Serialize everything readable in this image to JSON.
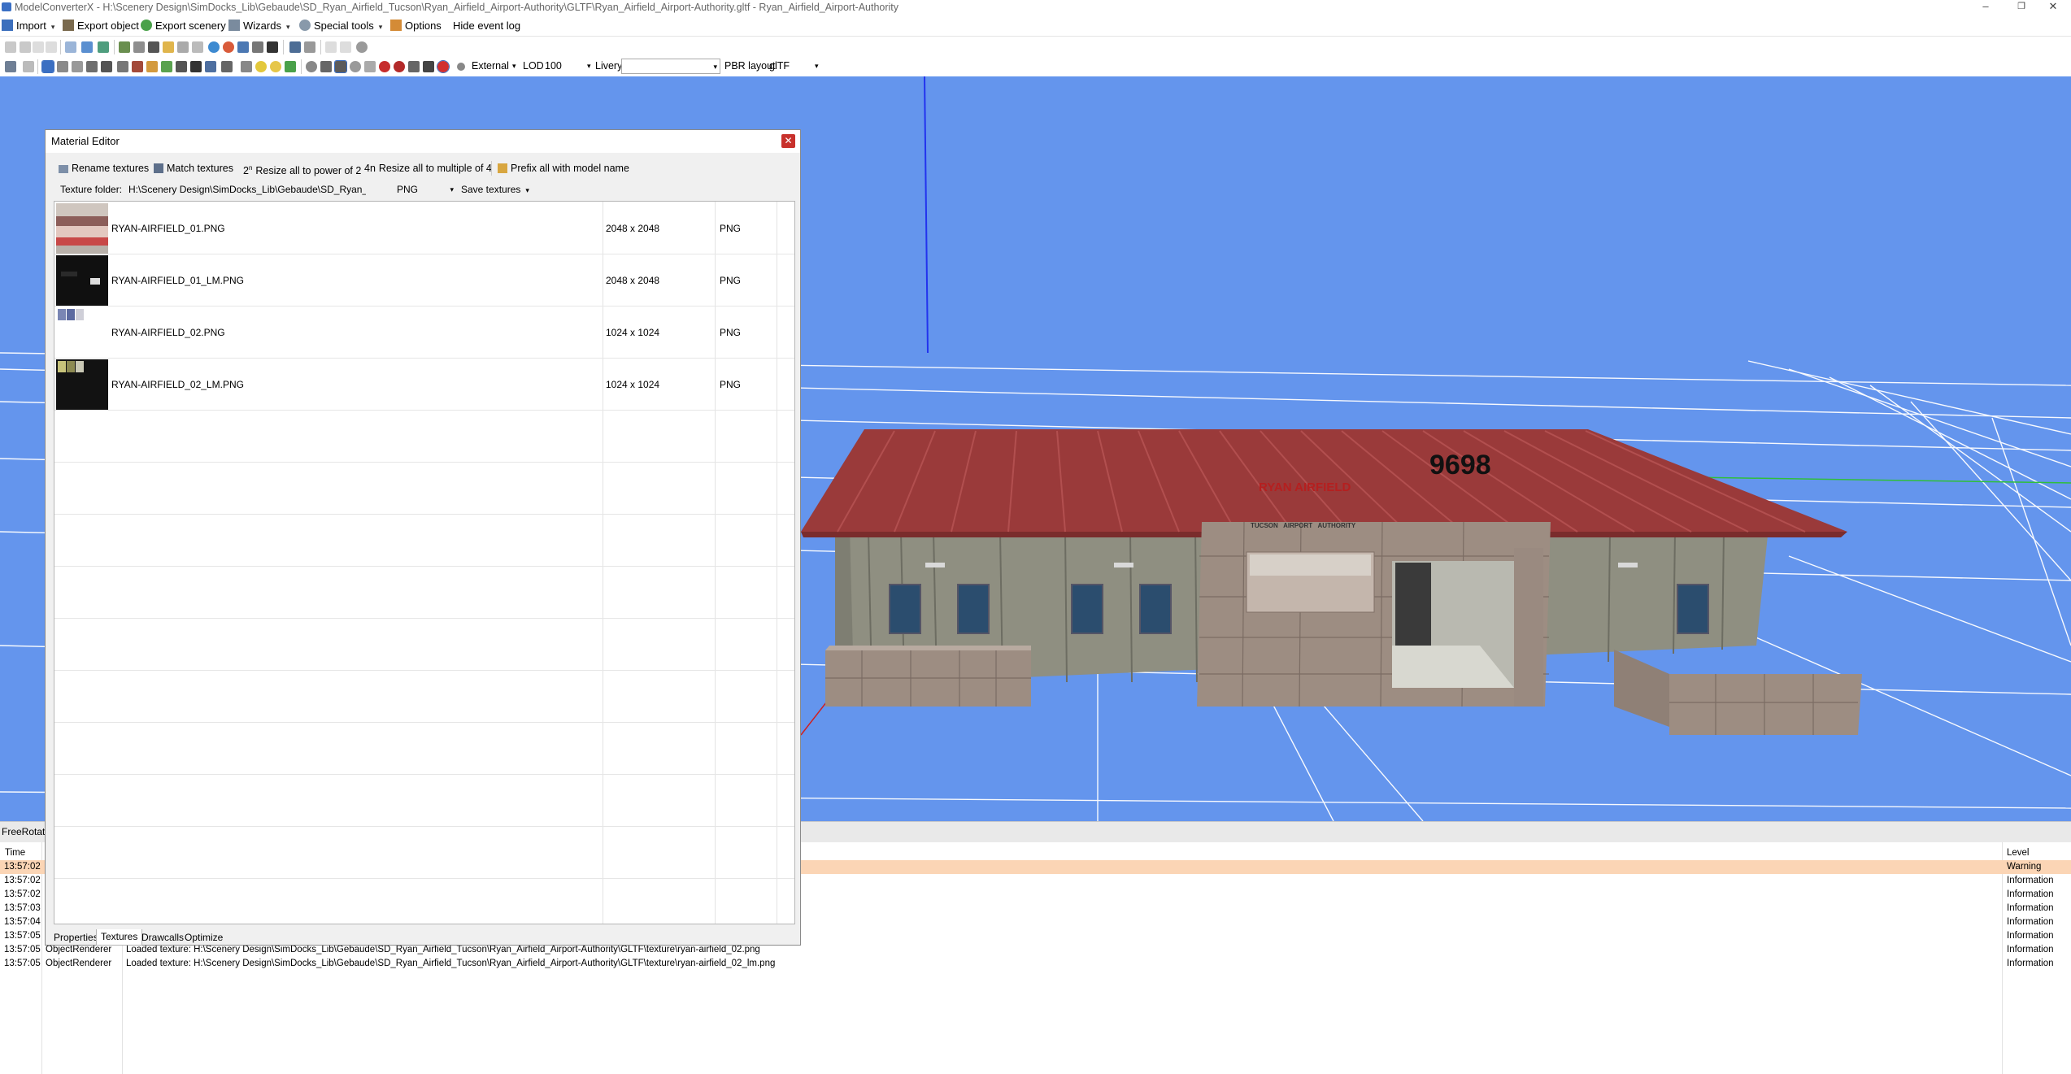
{
  "window": {
    "title": "ModelConverterX - H:\\Scenery Design\\SimDocks_Lib\\Gebaude\\SD_Ryan_Airfield_Tucson\\Ryan_Airfield_Airport-Authority\\GLTF\\Ryan_Airfield_Airport-Authority.gltf - Ryan_Airfield_Airport-Authority"
  },
  "menubar": {
    "import": "Import",
    "export_object": "Export object",
    "export_scenery": "Export scenery",
    "wizards": "Wizards",
    "special_tools": "Special tools",
    "options": "Options",
    "hide_event_log": "Hide event log"
  },
  "toolbar": {
    "view_mode": "External",
    "lod_label": "LOD",
    "lod_value": "100",
    "livery_label": "Livery",
    "livery_value": "",
    "pbr_label": "PBR layout",
    "pbr_value": "glTF"
  },
  "viewport": {
    "model_number": "9698",
    "sign_title": "RYAN AIRFIELD",
    "sign_subtitle": "TUCSON   AIRPORT   AUTHORITY",
    "background_color": "#6495ed"
  },
  "material_editor": {
    "title": "Material Editor",
    "tools": {
      "rename": "Rename textures",
      "match": "Match textures",
      "resize_pow2_prefix": "2",
      "resize_pow2_sup": "n",
      "resize_pow2": "Resize all to power of 2",
      "resize_mult4_prefix": "4n",
      "resize_mult4": "Resize all to multiple of 4",
      "prefix": "Prefix all with model name"
    },
    "texture_folder_label": "Texture folder:",
    "texture_folder_value": "H:\\Scenery Design\\SimDocks_Lib\\Gebaude\\SD_Ryan_Ai",
    "format": "PNG",
    "save_textures": "Save textures",
    "textures": [
      {
        "name": "RYAN-AIRFIELD_01.PNG",
        "size": "2048 x 2048",
        "format": "PNG"
      },
      {
        "name": "RYAN-AIRFIELD_01_LM.PNG",
        "size": "2048 x 2048",
        "format": "PNG"
      },
      {
        "name": "RYAN-AIRFIELD_02.PNG",
        "size": "1024 x 1024",
        "format": "PNG"
      },
      {
        "name": "RYAN-AIRFIELD_02_LM.PNG",
        "size": "1024 x 1024",
        "format": "PNG"
      }
    ],
    "tabs": [
      "Properties",
      "Textures",
      "Drawcalls",
      "Optimize"
    ],
    "active_tab": "Textures"
  },
  "status": {
    "mode": "FreeRotate"
  },
  "event_log": {
    "headers": {
      "time": "Time",
      "level": "Level"
    },
    "rows": [
      {
        "time": "13:57:02",
        "source": "",
        "message": "",
        "level": "Warning"
      },
      {
        "time": "13:57:02",
        "source": "",
        "message": "",
        "level": "Information"
      },
      {
        "time": "13:57:02",
        "source": "",
        "message": "",
        "level": "Information"
      },
      {
        "time": "13:57:03",
        "source": "",
        "message": "",
        "level": "Information"
      },
      {
        "time": "13:57:04",
        "source": "",
        "message": "",
        "level": "Information"
      },
      {
        "time": "13:57:05",
        "source": "",
        "message": "",
        "level": "Information"
      },
      {
        "time": "13:57:05",
        "source": "ObjectRenderer",
        "message": "Loaded texture: H:\\Scenery Design\\SimDocks_Lib\\Gebaude\\SD_Ryan_Airfield_Tucson\\Ryan_Airfield_Airport-Authority\\GLTF\\texture\\ryan-airfield_02.png",
        "level": "Information"
      },
      {
        "time": "13:57:05",
        "source": "ObjectRenderer",
        "message": "Loaded texture: H:\\Scenery Design\\SimDocks_Lib\\Gebaude\\SD_Ryan_Airfield_Tucson\\Ryan_Airfield_Airport-Authority\\GLTF\\texture\\ryan-airfield_02_lm.png",
        "level": "Information"
      }
    ],
    "warning_color": "#fbd5b5"
  }
}
